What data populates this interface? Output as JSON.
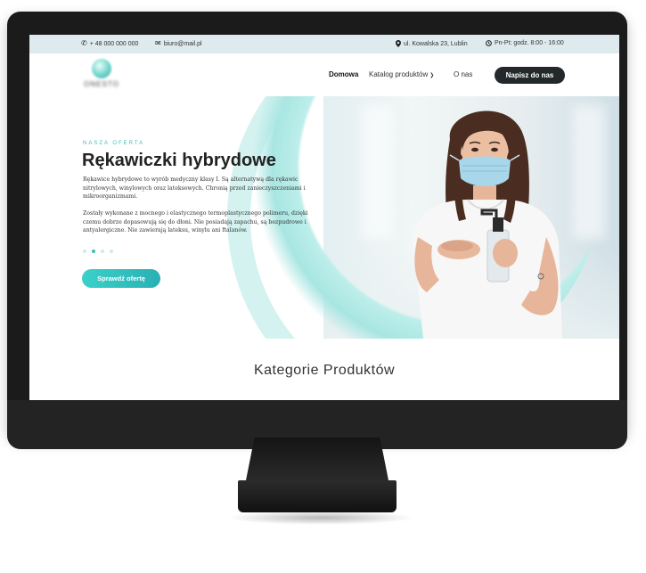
{
  "topbar": {
    "phone": "+ 48 000 000 000",
    "email": "biuro@mail.pl",
    "address": "ul. Kowalska 23, Lublin",
    "hours": "Pn-Pt: godz. 8:00 - 16:00"
  },
  "nav": {
    "logo_text": "ONESTO",
    "items": [
      "Domowa",
      "Katalog produktów",
      "O nas"
    ],
    "cta": "Napisz do nas"
  },
  "hero": {
    "eyebrow": "NASZA OFERTA",
    "title": "Rękawiczki hybrydowe",
    "para1": "Rękawice hybrydowe to wyrób medyczny klasy I. Są alternatywą dla rękawic nitrylowych, winylowych oraz lateksowych. Chronią przed zanieczyszczeniami i mikroorganizmami.",
    "para2": "Zostały wykonane z mocnego i elastycznego termoplastycznego polimeru, dzięki czemu dobrze dopasowują się do dłoni.  Nie posiadają zapachu, są bezpudrowe i antyalergiczne. Nie zawierają lateksu, winylu ani ftalanów.",
    "slider_active_index": 1,
    "slider_count": 4,
    "button": "Sprawdź ofertę"
  },
  "categories": {
    "title": "Kategorie Produktów"
  },
  "colors": {
    "accent": "#3fbdb5",
    "topbar_bg": "#dfeaee",
    "cta_bg": "#23292b",
    "monitor": "#1b1b1b"
  },
  "icons": {
    "phone": "phone-icon",
    "email": "envelope-icon",
    "address": "map-pin-icon",
    "hours": "clock-icon",
    "dropdown": "chevron-down-icon"
  }
}
